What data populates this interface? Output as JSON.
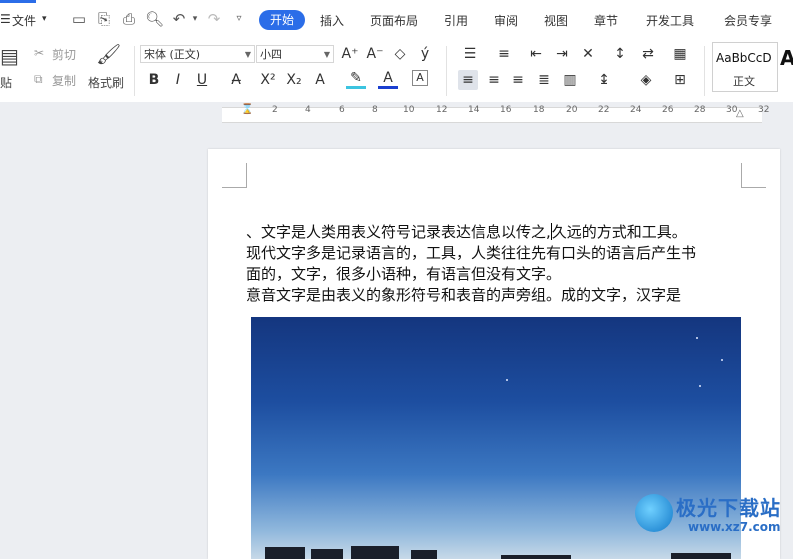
{
  "menu": {
    "file_label": "文件",
    "tabs": [
      "开始",
      "插入",
      "页面布局",
      "引用",
      "审阅",
      "视图",
      "章节",
      "开发工具",
      "会员专享"
    ]
  },
  "ribbon": {
    "paste_label": "贴",
    "cut_label": "剪切",
    "copy_label": "复制",
    "format_painter_label": "格式刷",
    "font_name": "宋体 (正文)",
    "font_size": "小四",
    "style_preview": "AaBbCcD",
    "style_name": "正文",
    "style_next_glyph": "A"
  },
  "ruler": {
    "numbers": [
      "2",
      "4",
      "6",
      "8",
      "10",
      "12",
      "14",
      "16",
      "18",
      "20",
      "22",
      "24",
      "26",
      "28",
      "30",
      "32"
    ]
  },
  "document": {
    "line1_a": "、文字是人类用表义符号记录表达信息以传之,",
    "line1_b": "久远的方式和工具。",
    "line2": "现代文字多是记录语言的，工具，人类往往先有口头的语言后产生书",
    "line3": "面的，文字，很多小语种，有语言但没有文字。",
    "line4": "意音文字是由表义的象形符号和表音的声旁组。成的文字，汉字是"
  },
  "watermark": {
    "title": "极光下载站",
    "url": "www.xz7.com"
  },
  "colors": {
    "accent": "#2b6de8",
    "highlight": "#3cc4e0",
    "font_color": "#1a3fd0"
  }
}
